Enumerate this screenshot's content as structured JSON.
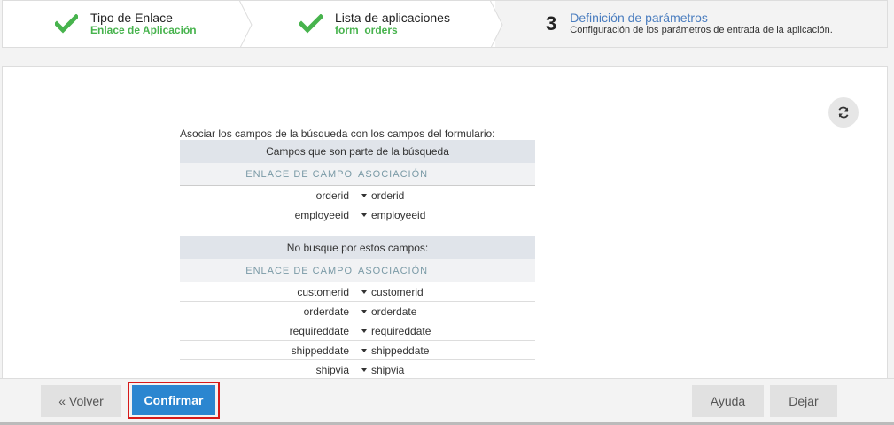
{
  "wizard": {
    "steps": [
      {
        "title": "Tipo de Enlace",
        "subtitle": "Enlace de Aplicación",
        "status": "done",
        "icon": "check-icon"
      },
      {
        "title": "Lista de aplicaciones",
        "subtitle": "form_orders",
        "status": "done",
        "icon": "check-icon"
      },
      {
        "number": "3",
        "title": "Definición de parámetros",
        "subtitle": "Configuración de los parámetros de entrada de la aplicación.",
        "status": "current"
      }
    ]
  },
  "panel": {
    "refresh_icon": "refresh-icon",
    "caption": "Asociar los campos de la búsqueda con los campos del formulario:",
    "search_fields": {
      "header": "Campos que son parte de la búsqueda",
      "col_left": "ENLACE DE CAMPO",
      "col_right": "ASOCIACIÓN",
      "rows": [
        {
          "field": "orderid",
          "value": "orderid"
        },
        {
          "field": "employeeid",
          "value": "employeeid"
        }
      ]
    },
    "other_fields": {
      "header": "No busque por estos campos:",
      "col_left": "ENLACE DE CAMPO",
      "col_right": "ASOCIACIÓN",
      "rows": [
        {
          "field": "customerid",
          "value": "customerid"
        },
        {
          "field": "orderdate",
          "value": "orderdate"
        },
        {
          "field": "requireddate",
          "value": "requireddate"
        },
        {
          "field": "shippeddate",
          "value": "shippeddate"
        },
        {
          "field": "shipvia",
          "value": "shipvia"
        }
      ]
    }
  },
  "footer": {
    "back": "« Volver",
    "confirm": "Confirmar",
    "help": "Ayuda",
    "leave": "Dejar"
  },
  "colors": {
    "check": "#47b34d",
    "accent": "#2b86d0",
    "current_step_title": "#4a7dbf",
    "highlight_border": "#d61a1a"
  }
}
